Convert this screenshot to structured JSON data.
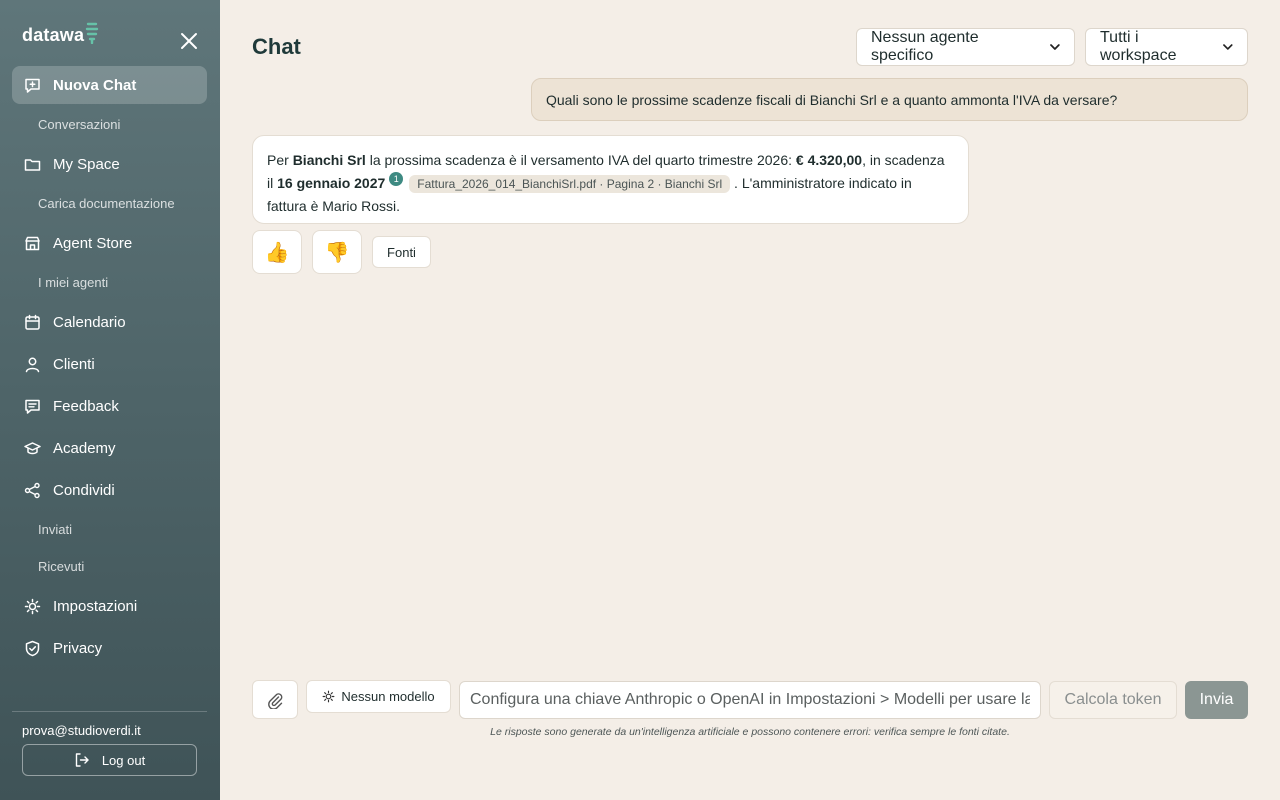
{
  "sidebar": {
    "logo": "datawa",
    "items": [
      {
        "label": "Nuova Chat",
        "icon": "chat-plus-icon"
      },
      {
        "label": "My Space",
        "icon": "folder-icon"
      },
      {
        "label": "Agent Store",
        "icon": "store-icon"
      },
      {
        "label": "Calendario",
        "icon": "calendar-icon"
      },
      {
        "label": "Clienti",
        "icon": "user-icon"
      },
      {
        "label": "Feedback",
        "icon": "feedback-icon"
      },
      {
        "label": "Academy",
        "icon": "graduation-cap-icon"
      },
      {
        "label": "Condividi",
        "icon": "share-icon"
      },
      {
        "label": "Impostazioni",
        "icon": "gear-icon"
      },
      {
        "label": "Privacy",
        "icon": "shield-icon"
      }
    ],
    "subitems": {
      "conversazioni": "Conversazioni",
      "carica_documentazione": "Carica documentazione",
      "miei_agenti": "I miei agenti",
      "inviati": "Inviati",
      "ricevuti": "Ricevuti"
    },
    "user_email": "prova@studioverdi.it",
    "logout_label": "Log out"
  },
  "header": {
    "title": "Chat",
    "agent_select": "Nessun agente specifico",
    "workspace_select": "Tutti i workspace"
  },
  "chat": {
    "user_message": "Quali sono le prossime scadenze fiscali di Bianchi Srl e a quanto ammonta l'IVA da versare?",
    "bot_message": {
      "p1": "Per ",
      "company": "Bianchi Srl",
      "p2": " la prossima scadenza è il versamento IVA del quarto trimestre 2026: ",
      "amount": "€ 4.320,00",
      "p3": ", in scadenza il ",
      "date": "16 gennaio 2027",
      "citation_number": "1",
      "citation_label": "Fattura_2026_014_BianchiSrl.pdf · Pagina 2 · Bianchi Srl",
      "p4": ". L'amministratore indicato in fattura è Mario Rossi."
    },
    "reactions": {
      "thumbs_up": "👍",
      "thumbs_down": "👎"
    },
    "sources_label": "Fonti"
  },
  "composer": {
    "model_label": "Nessun modello",
    "input_placeholder": "Configura una chiave Anthropic o OpenAI in Impostazioni > Modelli per usare la chat",
    "token_label": "Calcola token",
    "send_label": "Invia",
    "disclaimer": "Le risposte sono generate da un'intelligenza artificiale e possono contenere errori: verifica sempre le fonti citate."
  },
  "colors": {
    "sidebar_top": "#5f767a",
    "sidebar_bottom": "#3f5357",
    "background": "#f4eee7",
    "user_bubble": "#ede3d5",
    "citation_badge": "#3e8a82",
    "send_button": "#8b9693"
  }
}
